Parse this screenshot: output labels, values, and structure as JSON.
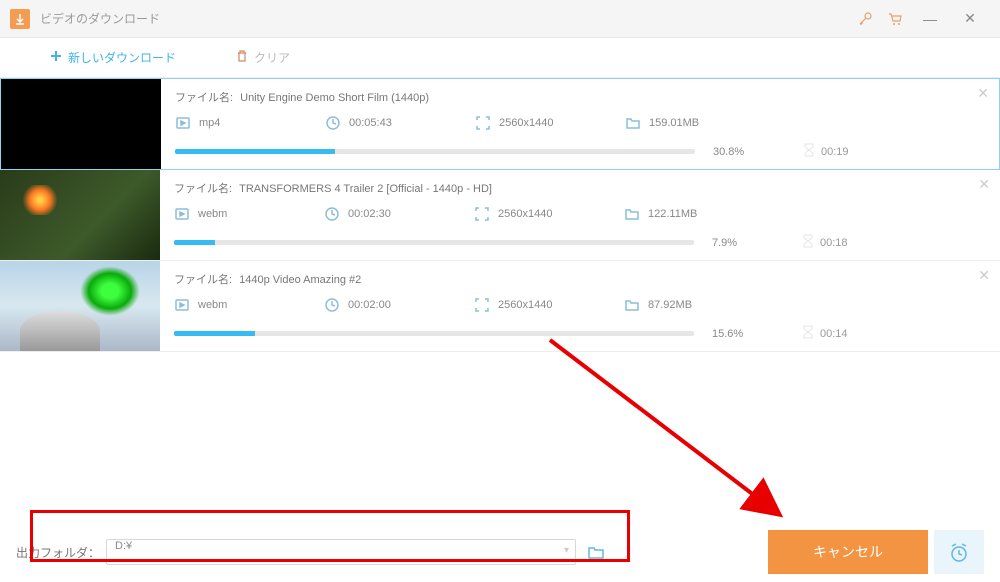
{
  "window": {
    "title": "ビデオのダウンロード"
  },
  "toolbar": {
    "new_download": "新しいダウンロード",
    "clear": "クリア"
  },
  "file_label": "ファイル名:",
  "downloads": [
    {
      "name": "Unity Engine Demo Short Film (1440p)",
      "format": "mp4",
      "duration": "00:05:43",
      "resolution": "2560x1440",
      "size": "159.01MB",
      "progress_pct": "30.8%",
      "progress": 30.8,
      "eta": "00:19"
    },
    {
      "name": "TRANSFORMERS 4 Trailer 2 [Official - 1440p - HD]",
      "format": "webm",
      "duration": "00:02:30",
      "resolution": "2560x1440",
      "size": "122.11MB",
      "progress_pct": "7.9%",
      "progress": 7.9,
      "eta": "00:18"
    },
    {
      "name": "1440p Video Amazing #2",
      "format": "webm",
      "duration": "00:02:00",
      "resolution": "2560x1440",
      "size": "87.92MB",
      "progress_pct": "15.6%",
      "progress": 15.6,
      "eta": "00:14"
    }
  ],
  "footer": {
    "output_label": "出力フォルダ：",
    "output_path": "D:¥",
    "cancel": "キャンセル"
  }
}
